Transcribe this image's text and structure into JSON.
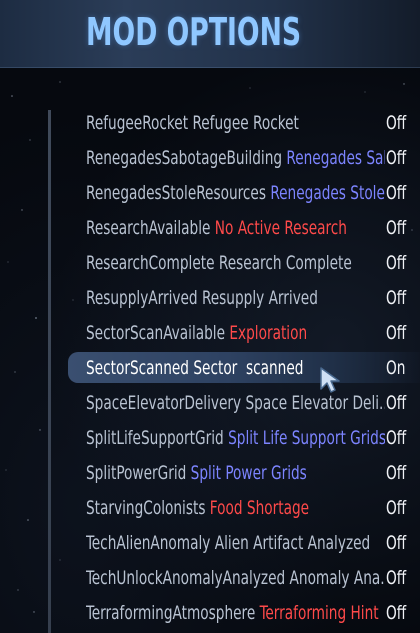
{
  "header": {
    "title": "MOD OPTIONS"
  },
  "options": [
    {
      "id": "RefugeeRocket",
      "label": "Refugee Rocket",
      "label_color": "plain",
      "value": "Off",
      "selected": false
    },
    {
      "id": "RenegadesSabotageBuilding",
      "label": "Renegades Sab",
      "label_color": "blue",
      "value": "Off",
      "selected": false
    },
    {
      "id": "RenegadesStoleResources",
      "label": "Renegades Stole",
      "label_color": "blue",
      "value": "Off",
      "selected": false
    },
    {
      "id": "ResearchAvailable",
      "label": "No Active Research",
      "label_color": "red",
      "value": "Off",
      "selected": false
    },
    {
      "id": "ResearchComplete",
      "label": "Research Complete",
      "label_color": "plain",
      "value": "Off",
      "selected": false
    },
    {
      "id": "ResupplyArrived",
      "label": "Resupply Arrived",
      "label_color": "plain",
      "value": "Off",
      "selected": false
    },
    {
      "id": "SectorScanAvailable",
      "label": "Exploration",
      "label_color": "red",
      "value": "Off",
      "selected": false
    },
    {
      "id": "SectorScanned",
      "label": "Sector  scanned",
      "label_color": "plain",
      "value": "On",
      "selected": true
    },
    {
      "id": "SpaceElevatorDelivery",
      "label": "Space Elevator Deli...",
      "label_color": "plain",
      "value": "Off",
      "selected": false
    },
    {
      "id": "SplitLifeSupportGrid",
      "label": "Split Life Support Grids",
      "label_color": "blue",
      "value": "Off",
      "selected": false
    },
    {
      "id": "SplitPowerGrid",
      "label": "Split Power Grids",
      "label_color": "blue",
      "value": "Off",
      "selected": false
    },
    {
      "id": "StarvingColonists",
      "label": "Food Shortage",
      "label_color": "red",
      "value": "Off",
      "selected": false
    },
    {
      "id": "TechAlienAnomaly",
      "label": "Alien Artifact Analyzed",
      "label_color": "plain",
      "value": "Off",
      "selected": false
    },
    {
      "id": "TechUnlockAnomalyAnalyzed",
      "label": "Anomaly Ana...",
      "label_color": "plain",
      "value": "Off",
      "selected": false
    },
    {
      "id": "TerraformingAtmosphere",
      "label": "Terraforming Hint",
      "label_color": "red",
      "value": "Off",
      "selected": false
    }
  ],
  "colors": {
    "title": "#8fc7ff",
    "label_plain": "#b9c3d2",
    "label_red": "#ff4a4a",
    "label_blue": "#7c84ff",
    "value": "#f0f2f6",
    "selected_bg": "#3a4f70"
  },
  "icons": {
    "cursor": "arrow-cursor-icon"
  }
}
